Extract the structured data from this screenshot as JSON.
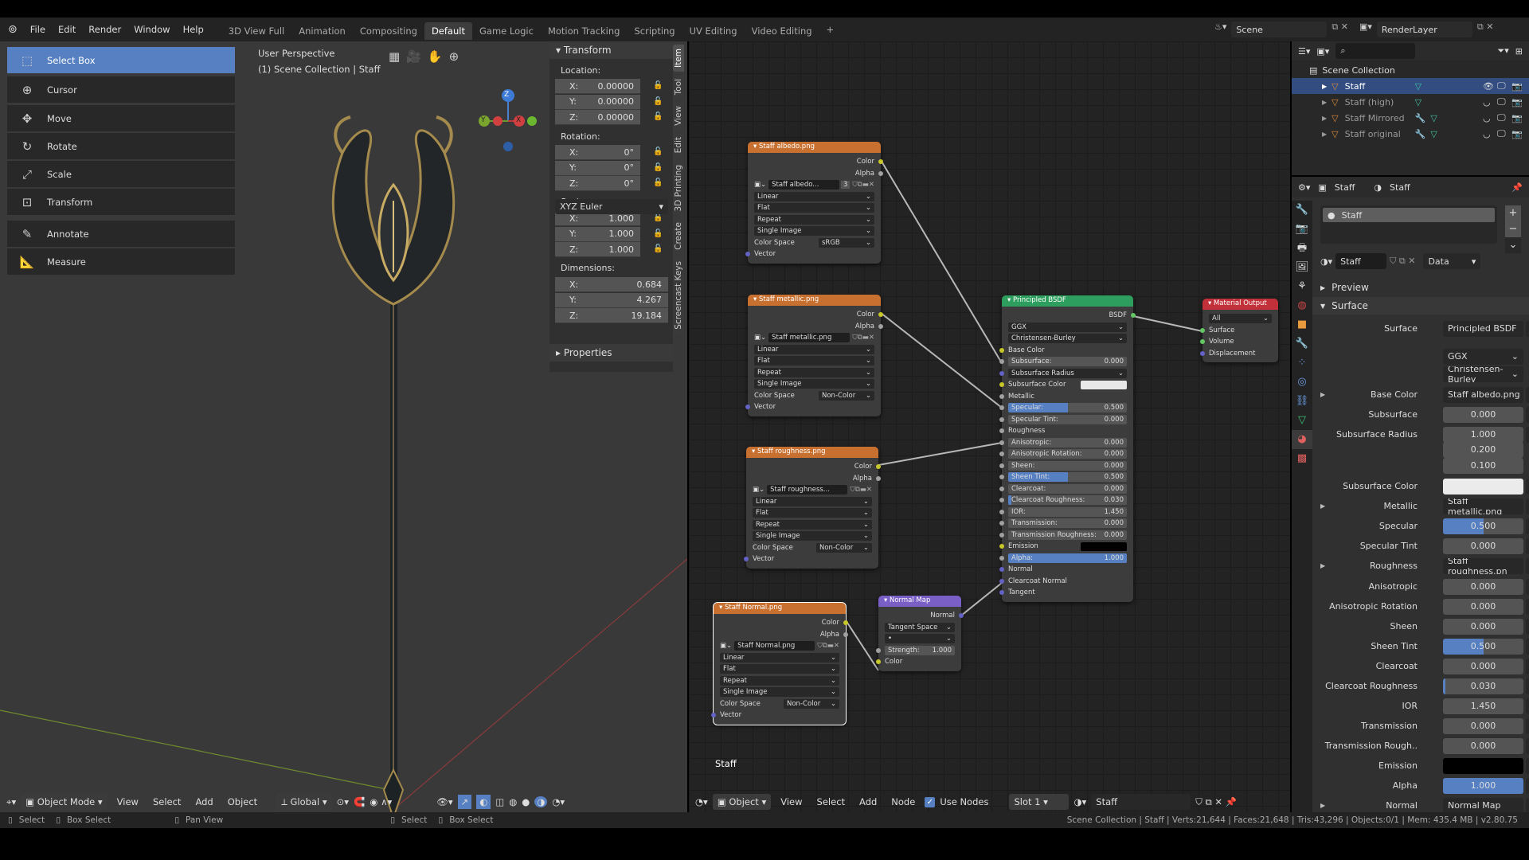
{
  "topbar": {
    "menus": [
      "File",
      "Edit",
      "Render",
      "Window",
      "Help"
    ],
    "workspaces": [
      "3D View Full",
      "Animation",
      "Compositing",
      "Default",
      "Game Logic",
      "Motion Tracking",
      "Scripting",
      "UV Editing",
      "Video Editing"
    ],
    "active_workspace": "Default",
    "add_label": "+",
    "scene": "Scene",
    "view_layer": "RenderLayer"
  },
  "toolbar": {
    "tools": [
      {
        "label": "Select Box",
        "icon": "select-box-icon",
        "active": true
      },
      {
        "label": "Cursor",
        "icon": "cursor-icon"
      },
      {
        "label": "Move",
        "icon": "move-icon"
      },
      {
        "label": "Rotate",
        "icon": "rotate-icon"
      },
      {
        "label": "Scale",
        "icon": "scale-icon"
      },
      {
        "label": "Transform",
        "icon": "transform-icon"
      },
      {
        "label": "Annotate",
        "icon": "annotate-icon"
      },
      {
        "label": "Measure",
        "icon": "measure-icon"
      }
    ]
  },
  "viewport": {
    "view_name": "User Perspective",
    "collection_info": "(1) Scene Collection | Staff",
    "gizmo": {
      "x": "X",
      "y": "Y",
      "z": "Z"
    },
    "header": {
      "mode": "Object Mode",
      "menus": [
        "View",
        "Select",
        "Add",
        "Object"
      ],
      "orientation": "Global"
    }
  },
  "npanel": {
    "title": "Transform",
    "location_label": "Location:",
    "location": [
      "0.00000",
      "0.00000",
      "0.00000"
    ],
    "rotation_label": "Rotation:",
    "rotation": [
      "0°",
      "0°",
      "0°"
    ],
    "rotation_mode": "XYZ Euler",
    "scale_label": "Scale:",
    "scale": [
      "1.000",
      "1.000",
      "1.000"
    ],
    "dimensions_label": "Dimensions:",
    "dimensions": [
      "0.684",
      "4.267",
      "19.184"
    ],
    "axes": [
      "X:",
      "Y:",
      "Z:"
    ],
    "properties_label": "Properties",
    "tabs": [
      "Item",
      "Tool",
      "View",
      "Edit",
      "3D Printing",
      "Create",
      "Screencast Keys"
    ]
  },
  "node_editor": {
    "frame_label": "Staff",
    "header": {
      "object_label": "Object",
      "menus": [
        "View",
        "Select",
        "Add",
        "Node"
      ],
      "use_nodes_label": "Use Nodes",
      "use_nodes": true,
      "slot": "Slot 1",
      "material": "Staff"
    },
    "colors": {
      "image": "#c7702f",
      "shader": "#2e9e5e",
      "output": "#c2303a",
      "vector": "#7a5fc6"
    },
    "nodes": [
      {
        "id": "albedo",
        "title": "Staff albedo.png",
        "kind": "image",
        "rows": [
          {
            "k": "out",
            "label": "Color",
            "s": "color"
          },
          {
            "k": "out",
            "label": "Alpha",
            "s": "float"
          },
          {
            "k": "img",
            "label": "Staff albedo...",
            "extra": "3"
          },
          {
            "k": "drop",
            "label": "Linear"
          },
          {
            "k": "drop",
            "label": "Flat"
          },
          {
            "k": "drop",
            "label": "Repeat"
          },
          {
            "k": "drop",
            "label": "Single Image"
          },
          {
            "k": "cs",
            "label": "Color Space",
            "value": "sRGB"
          },
          {
            "k": "in",
            "label": "Vector",
            "s": "vector"
          }
        ]
      },
      {
        "id": "metallic",
        "title": "Staff metallic.png",
        "kind": "image",
        "rows": [
          {
            "k": "out",
            "label": "Color",
            "s": "color"
          },
          {
            "k": "out",
            "label": "Alpha",
            "s": "float"
          },
          {
            "k": "img",
            "label": "Staff metallic.png"
          },
          {
            "k": "drop",
            "label": "Linear"
          },
          {
            "k": "drop",
            "label": "Flat"
          },
          {
            "k": "drop",
            "label": "Repeat"
          },
          {
            "k": "drop",
            "label": "Single Image"
          },
          {
            "k": "cs",
            "label": "Color Space",
            "value": "Non-Color"
          },
          {
            "k": "in",
            "label": "Vector",
            "s": "vector"
          }
        ]
      },
      {
        "id": "roughness",
        "title": "Staff roughness.png",
        "kind": "image",
        "rows": [
          {
            "k": "out",
            "label": "Color",
            "s": "color"
          },
          {
            "k": "out",
            "label": "Alpha",
            "s": "float"
          },
          {
            "k": "img",
            "label": "Staff roughness..."
          },
          {
            "k": "drop",
            "label": "Linear"
          },
          {
            "k": "drop",
            "label": "Flat"
          },
          {
            "k": "drop",
            "label": "Repeat"
          },
          {
            "k": "drop",
            "label": "Single Image"
          },
          {
            "k": "cs",
            "label": "Color Space",
            "value": "Non-Color"
          },
          {
            "k": "in",
            "label": "Vector",
            "s": "vector"
          }
        ]
      },
      {
        "id": "normalimg",
        "title": "Staff Normal.png",
        "kind": "image",
        "selected": true,
        "rows": [
          {
            "k": "out",
            "label": "Color",
            "s": "color"
          },
          {
            "k": "out",
            "label": "Alpha",
            "s": "float"
          },
          {
            "k": "img",
            "label": "Staff Normal.png"
          },
          {
            "k": "drop",
            "label": "Linear"
          },
          {
            "k": "drop",
            "label": "Flat"
          },
          {
            "k": "drop",
            "label": "Repeat"
          },
          {
            "k": "drop",
            "label": "Single Image"
          },
          {
            "k": "cs",
            "label": "Color Space",
            "value": "Non-Color"
          },
          {
            "k": "in",
            "label": "Vector",
            "s": "vector"
          }
        ]
      },
      {
        "id": "normalmap",
        "title": "Normal Map",
        "kind": "vector",
        "rows": [
          {
            "k": "out",
            "label": "Normal",
            "s": "vector"
          },
          {
            "k": "drop",
            "label": "Tangent Space"
          },
          {
            "k": "drop",
            "label": "•"
          },
          {
            "k": "slider",
            "label": "Strength:",
            "value": "1.000",
            "fill": 0,
            "s": "float"
          },
          {
            "k": "in",
            "label": "Color",
            "s": "color"
          }
        ]
      },
      {
        "id": "principled",
        "title": "Principled BSDF",
        "kind": "shader",
        "rows": [
          {
            "k": "out",
            "label": "BSDF",
            "s": "shader"
          },
          {
            "k": "drop",
            "label": "GGX"
          },
          {
            "k": "drop",
            "label": "Christensen-Burley"
          },
          {
            "k": "in",
            "label": "Base Color",
            "s": "color"
          },
          {
            "k": "slider",
            "label": "Subsurface:",
            "value": "0.000",
            "fill": 0,
            "s": "float"
          },
          {
            "k": "drop",
            "label": "Subsurface Radius",
            "s": "vector"
          },
          {
            "k": "color",
            "label": "Subsurface Color",
            "value": "#e8e8e8",
            "s": "color"
          },
          {
            "k": "in",
            "label": "Metallic",
            "s": "float"
          },
          {
            "k": "slider",
            "label": "Specular:",
            "value": "0.500",
            "fill": 0.5,
            "s": "float"
          },
          {
            "k": "slider",
            "label": "Specular Tint:",
            "value": "0.000",
            "fill": 0,
            "s": "float"
          },
          {
            "k": "in",
            "label": "Roughness",
            "s": "float"
          },
          {
            "k": "slider",
            "label": "Anisotropic:",
            "value": "0.000",
            "fill": 0,
            "s": "float"
          },
          {
            "k": "slider",
            "label": "Anisotropic Rotation:",
            "value": "0.000",
            "fill": 0,
            "s": "float"
          },
          {
            "k": "slider",
            "label": "Sheen:",
            "value": "0.000",
            "fill": 0,
            "s": "float"
          },
          {
            "k": "slider",
            "label": "Sheen Tint:",
            "value": "0.500",
            "fill": 0.5,
            "s": "float"
          },
          {
            "k": "slider",
            "label": "Clearcoat:",
            "value": "0.000",
            "fill": 0,
            "s": "float"
          },
          {
            "k": "slider",
            "label": "Clearcoat Roughness:",
            "value": "0.030",
            "fill": 0.03,
            "s": "float"
          },
          {
            "k": "slider",
            "label": "IOR:",
            "value": "1.450",
            "fill": 0,
            "s": "float"
          },
          {
            "k": "slider",
            "label": "Transmission:",
            "value": "0.000",
            "fill": 0,
            "s": "float"
          },
          {
            "k": "slider",
            "label": "Transmission Roughness:",
            "value": "0.000",
            "fill": 0,
            "s": "float"
          },
          {
            "k": "color",
            "label": "Emission",
            "value": "#000000",
            "s": "color"
          },
          {
            "k": "slider",
            "label": "Alpha:",
            "value": "1.000",
            "fill": 1,
            "s": "float"
          },
          {
            "k": "in",
            "label": "Normal",
            "s": "vector"
          },
          {
            "k": "in",
            "label": "Clearcoat Normal",
            "s": "vector"
          },
          {
            "k": "in",
            "label": "Tangent",
            "s": "vector"
          }
        ]
      },
      {
        "id": "output",
        "title": "Material Output",
        "kind": "output",
        "rows": [
          {
            "k": "drop",
            "label": "All"
          },
          {
            "k": "in",
            "label": "Surface",
            "s": "shader"
          },
          {
            "k": "in",
            "label": "Volume",
            "s": "shader"
          },
          {
            "k": "in",
            "label": "Displacement",
            "s": "vector"
          }
        ]
      }
    ]
  },
  "outliner": {
    "root": "Scene Collection",
    "items": [
      {
        "label": "Staff",
        "selected": true
      },
      {
        "label": "Staff (high)"
      },
      {
        "label": "Staff Mirrored",
        "modifier": true
      },
      {
        "label": "Staff original",
        "modifier": true
      }
    ]
  },
  "properties": {
    "object": "Staff",
    "material": "Staff",
    "slot_name": "Staff",
    "browse_name": "Staff",
    "link": "Data",
    "panels": {
      "preview": "Preview",
      "surface": "Surface"
    },
    "rows": [
      {
        "label": "Surface",
        "type": "link",
        "value": "Principled BSDF"
      },
      {
        "label": "",
        "type": "drop",
        "value": "GGX"
      },
      {
        "label": "",
        "type": "drop",
        "value": "Christensen-Burley"
      },
      {
        "label": "Base Color",
        "type": "link",
        "value": "Staff albedo.png",
        "expand": true
      },
      {
        "label": "Subsurface",
        "type": "num",
        "value": "0.000",
        "fill": 0
      },
      {
        "label": "Subsurface Radius",
        "type": "num",
        "value": "1.000",
        "fill": 0
      },
      {
        "label": "",
        "type": "num",
        "value": "0.200",
        "fill": 0
      },
      {
        "label": "",
        "type": "num",
        "value": "0.100",
        "fill": 0
      },
      {
        "label": "Subsurface Color",
        "type": "color",
        "value": "#ebebeb"
      },
      {
        "label": "Metallic",
        "type": "link",
        "value": "Staff metallic.png",
        "expand": true
      },
      {
        "label": "Specular",
        "type": "num",
        "value": "0.500",
        "fill": 0.5
      },
      {
        "label": "Specular Tint",
        "type": "num",
        "value": "0.000",
        "fill": 0
      },
      {
        "label": "Roughness",
        "type": "link",
        "value": "Staff roughness.pn",
        "expand": true
      },
      {
        "label": "Anisotropic",
        "type": "num",
        "value": "0.000",
        "fill": 0
      },
      {
        "label": "Anisotropic Rotation",
        "type": "num",
        "value": "0.000",
        "fill": 0
      },
      {
        "label": "Sheen",
        "type": "num",
        "value": "0.000",
        "fill": 0
      },
      {
        "label": "Sheen Tint",
        "type": "num",
        "value": "0.500",
        "fill": 0.5
      },
      {
        "label": "Clearcoat",
        "type": "num",
        "value": "0.000",
        "fill": 0
      },
      {
        "label": "Clearcoat Roughness",
        "type": "num",
        "value": "0.030",
        "fill": 0.03
      },
      {
        "label": "IOR",
        "type": "num",
        "value": "1.450",
        "fill": 0
      },
      {
        "label": "Transmission",
        "type": "num",
        "value": "0.000",
        "fill": 0
      },
      {
        "label": "Transmission Rough..",
        "type": "num",
        "value": "0.000",
        "fill": 0
      },
      {
        "label": "Emission",
        "type": "color",
        "value": "#000000"
      },
      {
        "label": "Alpha",
        "type": "num",
        "value": "1.000",
        "fill": 1
      },
      {
        "label": "Normal",
        "type": "link",
        "value": "Normal Map",
        "expand": true
      }
    ]
  },
  "statusbar": {
    "left": [
      {
        "key": "Select"
      },
      {
        "key": "Box Select"
      },
      {
        "key": "Pan View"
      },
      {
        "key": "Select"
      },
      {
        "key": "Box Select"
      }
    ],
    "stats": "Scene Collection | Staff | Verts:21,644 | Faces:21,648 | Tris:43,296 | Objects:0/1 | Mem: 435.4 MB | v2.80.75"
  }
}
